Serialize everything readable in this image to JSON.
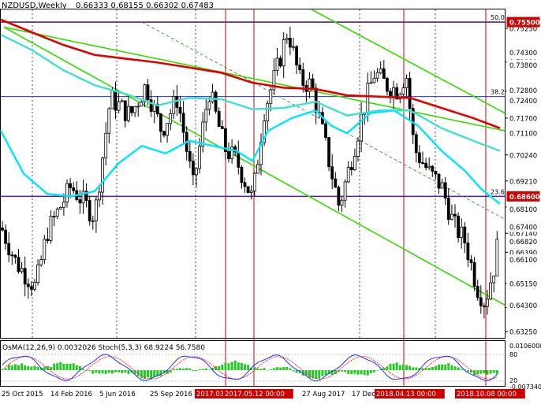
{
  "chart_data": {
    "type": "candlestick",
    "symbol_label": "NZDUSD,Weekly",
    "ohlc_header": "0.66333 0.68155 0.66302 0.67483",
    "price_range": [
      0.63,
      0.76
    ],
    "x_tick_labels": [
      "25 Oct 2015",
      "14 Feb 2016",
      "5 Jun 2016",
      "25 Sep 2016",
      "17",
      "27 Aug 2017",
      "17 Dec",
      "8"
    ],
    "y_tick_labels": [
      "0.75250",
      "0.73920",
      "0.72770",
      "0.71700",
      "0.70240",
      "0.69210",
      "0.68180",
      "0.67140",
      "0.66390",
      "0.65150",
      "0.64200",
      "0.63250"
    ],
    "price_levels": [
      {
        "label": "0.75500",
        "price": 0.755,
        "color": "#d00000",
        "style": "solid"
      },
      {
        "label": "0.74300",
        "price": 0.743,
        "color": "#ffffff",
        "style": "none"
      },
      {
        "label": "0.73800",
        "price": 0.738,
        "color": "#ffffff",
        "style": "none"
      },
      {
        "label": "0.72800",
        "price": 0.728,
        "color": "#ffffff",
        "style": "none"
      },
      {
        "label": "0.72400",
        "price": 0.724,
        "color": "#ffffff",
        "style": "none"
      },
      {
        "label": "0.71100",
        "price": 0.711,
        "color": "#ffffff",
        "style": "none"
      },
      {
        "label": "0.68600",
        "price": 0.686,
        "color": "#d00000",
        "style": "solid"
      },
      {
        "label": "0.68100",
        "price": 0.681,
        "color": "#ffffff",
        "style": "none"
      },
      {
        "label": "0.67400",
        "price": 0.674,
        "color": "#ffffff",
        "style": "none"
      },
      {
        "label": "0.66820",
        "price": 0.6682,
        "color": "#ffffff",
        "style": "none"
      },
      {
        "label": "0.66100",
        "price": 0.661,
        "color": "#ffffff",
        "style": "none"
      },
      {
        "label": "0.65150",
        "price": 0.6515,
        "color": "#ffffff",
        "style": "none"
      },
      {
        "label": "0.64300",
        "price": 0.643,
        "color": "#ffffff",
        "style": "none"
      }
    ],
    "fibonacci_levels": [
      {
        "label": "50.0",
        "price": 0.755
      },
      {
        "label": "38.2",
        "price": 0.7255
      },
      {
        "label": "23.6",
        "price": 0.686
      }
    ],
    "vertical_markers": [
      {
        "label": "2017.03",
        "color": "#d00000"
      },
      {
        "label": "2017.05.12 00:00",
        "color": "#d00000"
      },
      {
        "label": "2018.04.13 00:00",
        "color": "#d00000"
      },
      {
        "label": "2018.10.08 00:00",
        "color": "#d00000"
      }
    ],
    "indicator_label": "OsMA(12,26,9) 0.0032026  Stoch(5,3,3) 68.9224 56.7580",
    "indicator_axis_labels": [
      "0.0106000",
      "80",
      "20",
      "-0.0073400"
    ],
    "colors": {
      "bull": "#000000",
      "bear": "#000000",
      "ma_red": "#e00000",
      "ma_cyan_thick": "#40e0d0",
      "ma_cyan": "#00e5ff",
      "channel": "#33dd00",
      "osma": "#22cc22",
      "stoch_main": "#2030ff",
      "stoch_signal": "#ff2020",
      "price_box": "#d00000"
    }
  }
}
